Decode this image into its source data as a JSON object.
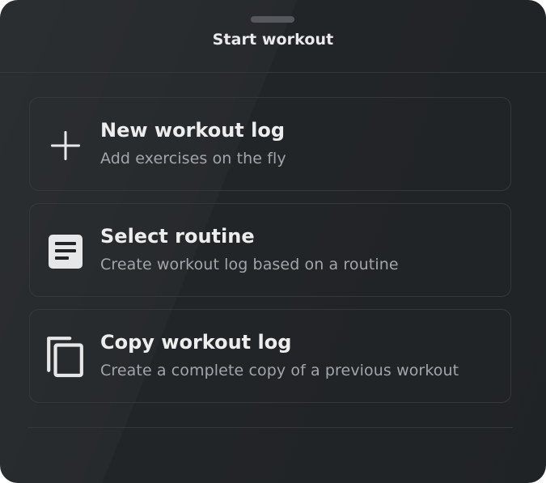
{
  "sheet": {
    "title": "Start workout"
  },
  "options": [
    {
      "title": "New workout log",
      "subtitle": "Add exercises on the fly",
      "icon": "plus-icon"
    },
    {
      "title": "Select routine",
      "subtitle": "Create workout log based on a routine",
      "icon": "document-icon"
    },
    {
      "title": "Copy workout log",
      "subtitle": "Create a complete copy of a previous workout",
      "icon": "copy-icon"
    }
  ],
  "colors": {
    "background": "#222528",
    "card_border": "#34383c",
    "title_text": "#eceded",
    "subtitle_text": "#a2a6aa",
    "icon": "#e6e7e8"
  }
}
